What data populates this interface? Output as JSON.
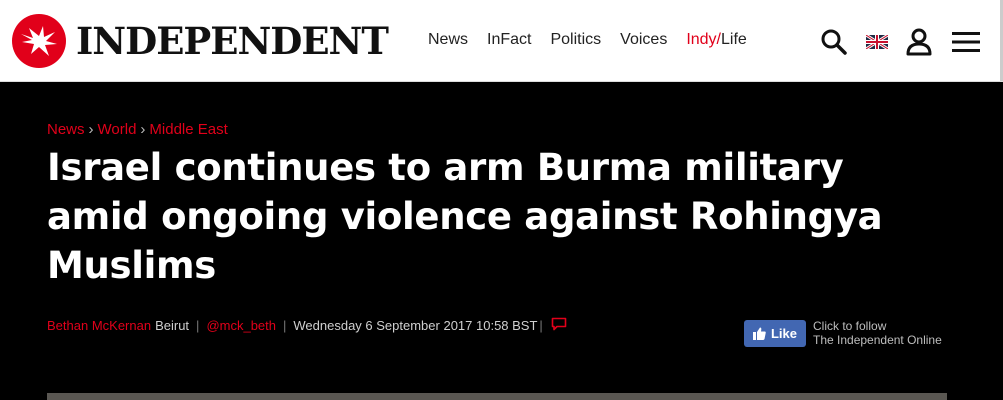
{
  "header": {
    "logo_text": "INDEPENDENT",
    "nav": {
      "news": "News",
      "infact": "InFact",
      "politics": "Politics",
      "voices": "Voices",
      "indy": "Indy/",
      "life": "Life"
    },
    "icons": [
      "search-icon",
      "uk-flag-icon",
      "user-icon",
      "menu-icon"
    ]
  },
  "article": {
    "breadcrumbs": [
      "News",
      "World",
      "Middle East"
    ],
    "title": "Israel continues to arm Burma military amid ongoing violence against Rohingya Muslims",
    "byline": {
      "author": "Bethan McKernan",
      "location": "Beirut",
      "twitter": "@mck_beth",
      "date": "Wednesday 6 September 2017 10:58 BST"
    }
  },
  "social": {
    "like_label": "Like",
    "follow_line1": "Click to follow",
    "follow_line2": "The Independent Online"
  },
  "colors": {
    "accent": "#e1001a",
    "facebook": "#4267b2",
    "background": "#000000"
  }
}
